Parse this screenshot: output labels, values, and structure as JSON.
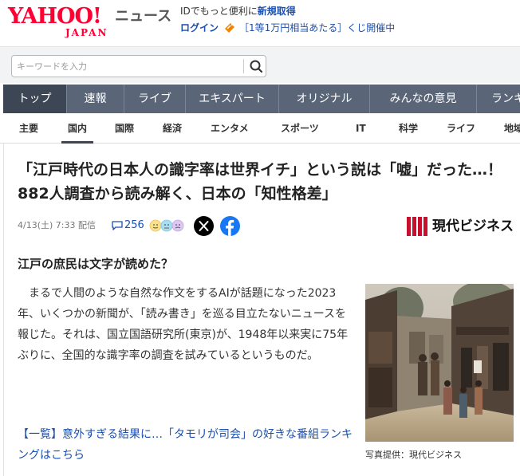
{
  "header": {
    "logo_main": "YAHOO!",
    "logo_sub": "JAPAN",
    "service": "ニュース",
    "promo_text": "IDでもっと便利に",
    "promo_link": "新規取得",
    "login": "ログイン",
    "kuji_text": "［1等1万円相当あたる］くじ開催中"
  },
  "search": {
    "placeholder": "キーワードを入力"
  },
  "main_nav": [
    "トップ",
    "速報",
    "ライブ",
    "エキスパート",
    "オリジナル",
    "みんなの意見",
    "ランキ"
  ],
  "sub_nav": [
    "主要",
    "国内",
    "国際",
    "経済",
    "エンタメ",
    "スポーツ",
    "IT",
    "科学",
    "ライフ",
    "地域"
  ],
  "article": {
    "title": "「江戸時代の日本人の識字率は世界イチ」という説は「嘘」だった…！882人調査から読み解く、日本の「知性格差」",
    "meta": "4/13(土) 7:33 配信",
    "comment_count": "256",
    "publisher": "現代ビジネス",
    "subheading": "江戸の庶民は文字が読めた？",
    "body": "　まるで人間のような自然な作文をするAIが話題になった2023年、いくつかの新聞が、「読み書き」を巡る目立たないニュースを報じた。それは、国立国語研究所(東京)が、1948年以来実に75年ぶりに、全国的な識字率の調査を試みているというものだ。",
    "link": "【一覧】意外すぎる結果に…「タモリが司会」の好きな番組ランキングはこちら",
    "photo_caption": "写真提供：現代ビジネス"
  },
  "colors": {
    "brand_red": "#ff0033",
    "nav_bg": "#5a6678",
    "nav_active": "#3d4654",
    "link_blue": "#1a4fb0",
    "kuji_orange": "#f08300",
    "facebook": "#1877f2"
  },
  "icons": [
    "kuji-ticket-icon",
    "search-icon",
    "comment-icon",
    "reaction-faces-icon",
    "x-logo-icon",
    "facebook-icon",
    "publisher-logo-icon"
  ]
}
